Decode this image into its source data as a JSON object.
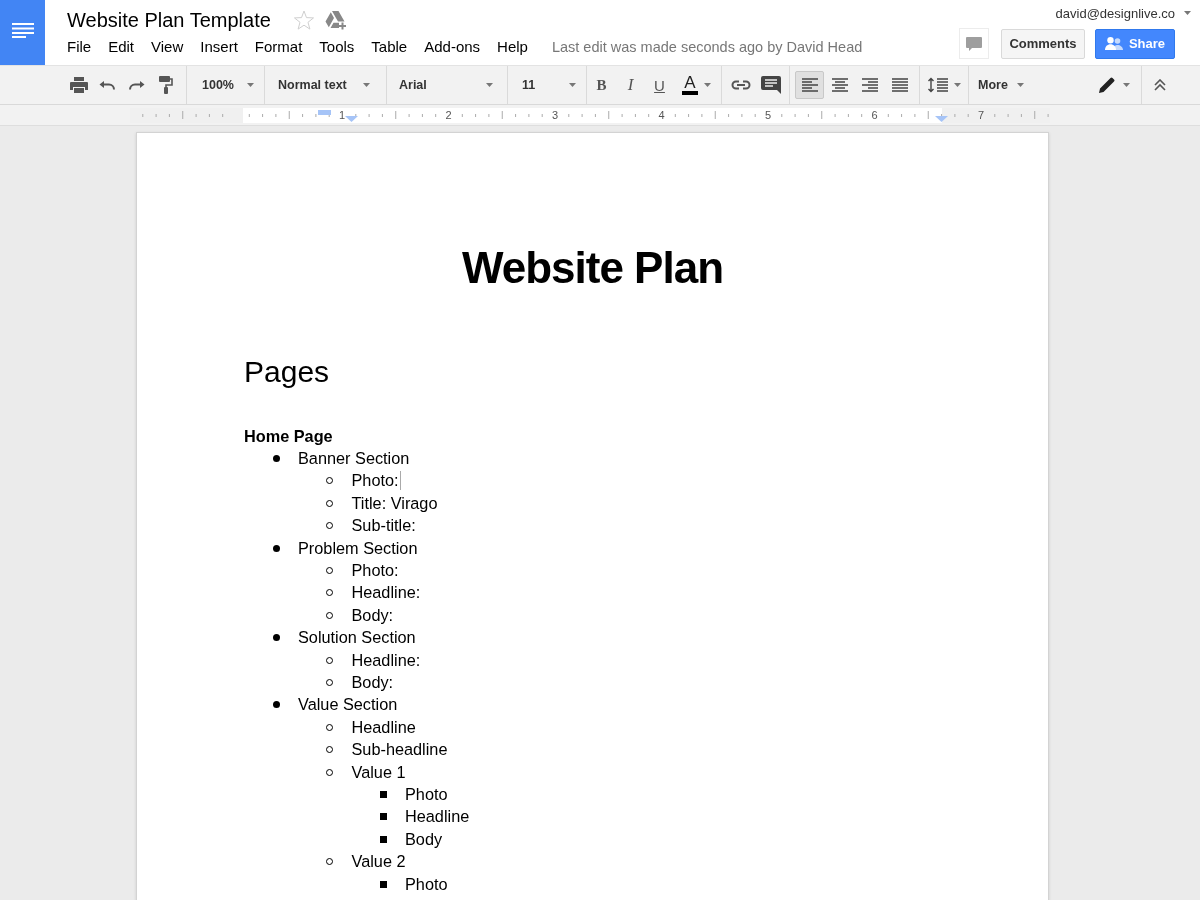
{
  "header": {
    "title": "Website Plan Template",
    "starred": false,
    "menu": [
      "File",
      "Edit",
      "View",
      "Insert",
      "Format",
      "Tools",
      "Table",
      "Add-ons",
      "Help"
    ],
    "last_edit": "Last edit was made seconds ago by David Head",
    "account": "david@designlive.co",
    "comments_button": "Comments",
    "share_button": "Share"
  },
  "toolbar": {
    "zoom": "100%",
    "style": "Normal text",
    "font": "Arial",
    "size": "11",
    "format": [
      {
        "kind": "bold",
        "label": "B"
      },
      {
        "kind": "italic",
        "label": "I"
      },
      {
        "kind": "underline",
        "label": "U"
      }
    ],
    "text_color": "A",
    "alignments": [
      {
        "kind": "left",
        "selected": true
      },
      {
        "kind": "center",
        "selected": false
      },
      {
        "kind": "right",
        "selected": false
      },
      {
        "kind": "justify",
        "selected": false
      }
    ],
    "more": "More"
  },
  "ruler": {
    "numbers": [
      "1",
      "2",
      "3",
      "4",
      "5",
      "6",
      "7"
    ]
  },
  "document": {
    "title": "Website Plan",
    "heading": "Pages",
    "subheading": "Home Page",
    "outline": [
      {
        "text": "Banner Section",
        "cursor": false,
        "children": [
          {
            "text": "Photo:",
            "cursor": true
          },
          {
            "text": "Title: Virago",
            "cursor": false
          },
          {
            "text": "Sub-title:",
            "cursor": false
          }
        ]
      },
      {
        "text": "Problem Section",
        "cursor": false,
        "children": [
          {
            "text": "Photo:",
            "cursor": false
          },
          {
            "text": "Headline:",
            "cursor": false
          },
          {
            "text": "Body:",
            "cursor": false
          }
        ]
      },
      {
        "text": "Solution Section",
        "cursor": false,
        "children": [
          {
            "text": "Headline:",
            "cursor": false
          },
          {
            "text": "Body:",
            "cursor": false
          }
        ]
      },
      {
        "text": "Value Section",
        "cursor": false,
        "children": [
          {
            "text": "Headline",
            "cursor": false
          },
          {
            "text": "Sub-headline",
            "cursor": false
          },
          {
            "text": "Value 1",
            "cursor": false,
            "children": [
              {
                "text": "Photo",
                "cursor": false
              },
              {
                "text": "Headline",
                "cursor": false
              },
              {
                "text": "Body",
                "cursor": false
              }
            ]
          },
          {
            "text": "Value 2",
            "cursor": false,
            "children": [
              {
                "text": "Photo",
                "cursor": false
              }
            ]
          }
        ]
      }
    ]
  }
}
